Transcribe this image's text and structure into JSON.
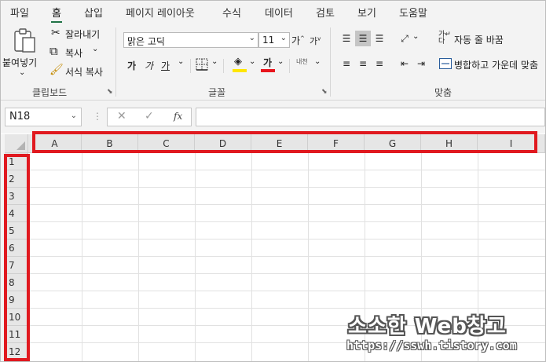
{
  "menu": {
    "tabs": [
      "파일",
      "홈",
      "삽입",
      "페이지 레이아웃",
      "수식",
      "데이터",
      "검토",
      "보기",
      "도움말"
    ],
    "active": "홈"
  },
  "ribbon": {
    "clipboard": {
      "paste": "붙여넣기",
      "cut": "잘라내기",
      "copy": "복사",
      "format_painter": "서식 복사",
      "label": "클립보드"
    },
    "font": {
      "name": "맑은 고딕",
      "size": "11",
      "label": "글꼴",
      "bold": "가",
      "italic": "가",
      "underline": "가",
      "grow": "가",
      "shrink": "가",
      "font_color": "가",
      "phonetic": "내천"
    },
    "alignment": {
      "wrap_text": "자동 줄 바꿈",
      "merge_center": "병합하고 가운데 맞춤",
      "label": "맞춤"
    }
  },
  "formula_bar": {
    "name_box": "N18",
    "fx_label": "fx"
  },
  "sheet": {
    "columns": [
      "A",
      "B",
      "C",
      "D",
      "E",
      "F",
      "G",
      "H",
      "I"
    ],
    "rows": [
      "1",
      "2",
      "3",
      "4",
      "5",
      "6",
      "7",
      "8",
      "9",
      "10",
      "11",
      "12"
    ]
  },
  "watermark": {
    "title": "소소한 Web창고",
    "url": "https://sswh.tistory.com"
  },
  "colors": {
    "accent": "#217346",
    "highlight": "#e0191f",
    "font_color_bar": "#e8141c",
    "fill_color_bar": "#ffe600"
  }
}
